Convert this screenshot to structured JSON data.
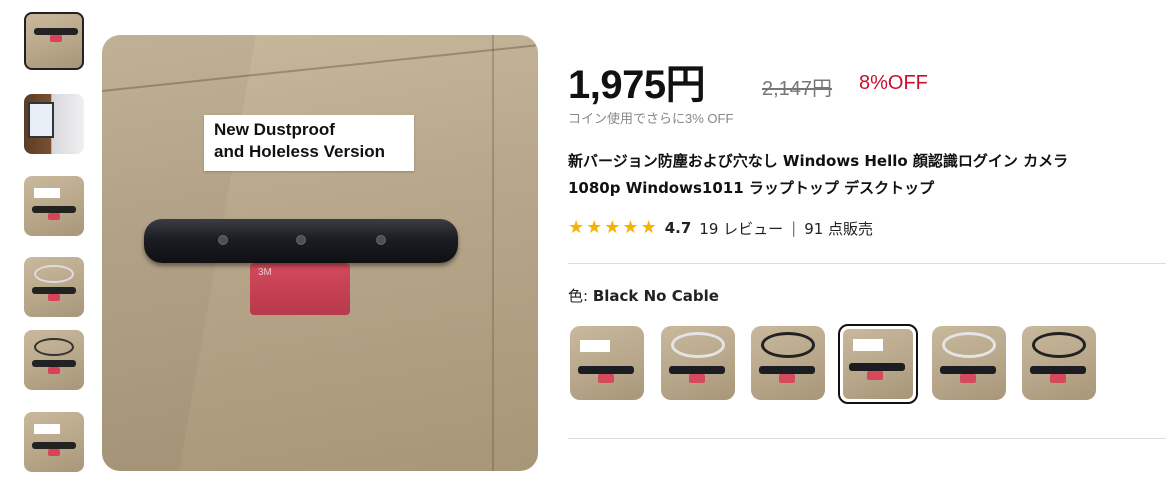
{
  "main_image": {
    "label_line1": "New Dustproof",
    "label_line2": "and Holeless Version",
    "pad_brand": "3M"
  },
  "product": {
    "price": "1,975円",
    "original_price": "2,147円",
    "discount": "8%OFF",
    "coin_note": "コイン使用でさらに3% OFF",
    "title_line1": "新バージョン防塵および穴なし Windows Hello 顔認識ログイン カメラ",
    "title_line2": "1080p Windows1011 ラップトップ デスクトップ",
    "rating": "4.7",
    "review_count": "19 レビュー",
    "separator": "|",
    "sold": "91 点販売",
    "stars": 4.7
  },
  "color_selector": {
    "label_prefix": "色:",
    "selected_value": "Black No Cable",
    "selected_index": 3
  },
  "colors": {
    "price": "#111111",
    "discount": "#c8102e",
    "star": "#f5b301"
  }
}
